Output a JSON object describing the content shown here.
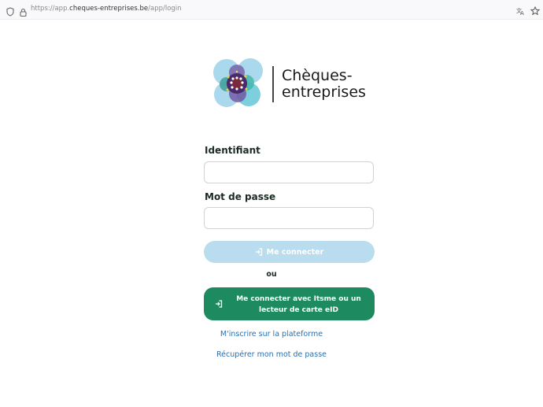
{
  "browser": {
    "url_prefix": "https://app.",
    "url_domain": "cheques-entreprises.be",
    "url_path": "/app/login"
  },
  "brand": {
    "line1": "Chèques-",
    "line2": "entreprises"
  },
  "form": {
    "identifiant_label": "Identifiant",
    "identifiant_value": "",
    "password_label": "Mot de passe",
    "password_value": "",
    "login_button": "Me connecter",
    "or_text": "ou",
    "itsme_button": "Me connecter avec Itsme ou un lecteur de carte eID",
    "register_link": "M'inscrire sur la plateforme",
    "recover_link": "Récupérer mon mot de passe"
  },
  "colors": {
    "login_button_disabled": "#b9dcef",
    "itsme_button": "#1e8a5f",
    "link": "#2a6fae"
  }
}
